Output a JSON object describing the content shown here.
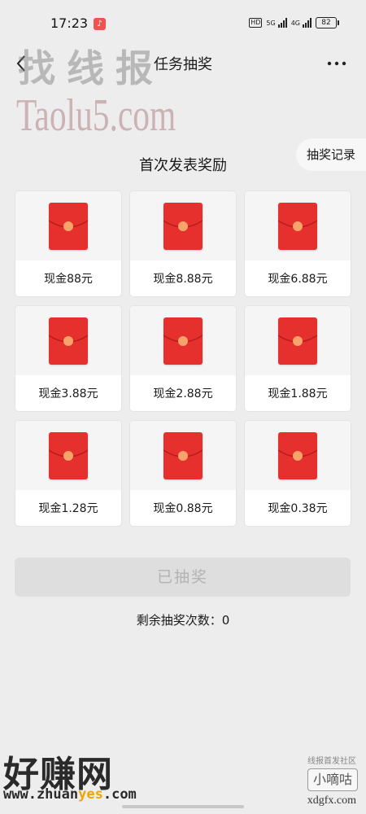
{
  "status_bar": {
    "time": "17:23",
    "app_notification_glyph": "♪",
    "hd_label": "HD",
    "network_1": "5G",
    "network_2": "4G",
    "battery": "82"
  },
  "nav": {
    "title": "任务抽奖",
    "back_icon": "chevron-left-icon",
    "more_icon": "more-horizontal-icon"
  },
  "record_tab": {
    "label": "抽奖记录"
  },
  "section": {
    "title": "首次发表奖励"
  },
  "rewards": [
    {
      "label": "现金88元"
    },
    {
      "label": "现金8.88元"
    },
    {
      "label": "现金6.88元"
    },
    {
      "label": "现金3.88元"
    },
    {
      "label": "现金2.88元"
    },
    {
      "label": "现金1.88元"
    },
    {
      "label": "现金1.28元"
    },
    {
      "label": "现金0.88元"
    },
    {
      "label": "现金0.38元"
    }
  ],
  "draw_button": {
    "label": "已抽奖",
    "disabled": true
  },
  "remaining": {
    "text": "剩余抽奖次数：0"
  },
  "watermarks": {
    "top_cn": "找线报",
    "top_en": "Taolu5.com",
    "bottom_left_cn": "好赚网",
    "bottom_left_url_prefix": "www.zhuan",
    "bottom_left_url_highlight": "yes",
    "bottom_left_url_suffix": ".com",
    "bottom_right_small": "线报首发社区",
    "bottom_right_name": "小嘀咕",
    "bottom_right_url": "xdgfx.com"
  },
  "colors": {
    "background": "#ededed",
    "envelope_red": "#e5302e",
    "seal_orange": "#f7a36a",
    "disabled_button": "#dedede",
    "disabled_text": "#b3b3b3"
  }
}
